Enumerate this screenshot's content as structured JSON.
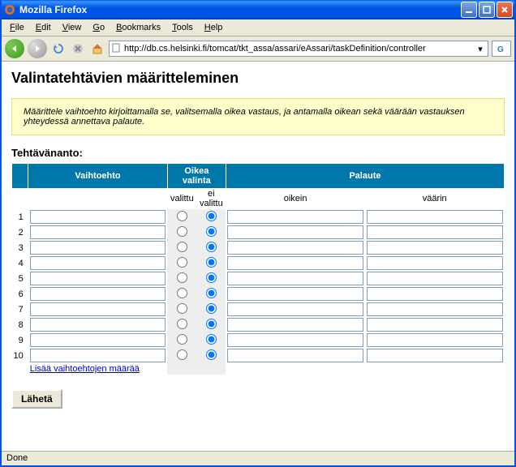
{
  "window": {
    "title": "Mozilla Firefox"
  },
  "menubar": {
    "file": "File",
    "edit": "Edit",
    "view": "View",
    "go": "Go",
    "bookmarks": "Bookmarks",
    "tools": "Tools",
    "help": "Help"
  },
  "toolbar": {
    "url": "http://db.cs.helsinki.fi/tomcat/tkt_assa/assari/eAssari/taskDefinition/controller"
  },
  "page": {
    "heading": "Valintatehtävien määritteleminen",
    "info": "Määrittele vaihtoehto kirjoittamalla se, valitsemalla oikea vastaus, ja antamalla oikean sekä väärään vastauksen yhteydessä annettava palaute.",
    "assignment_label": "Tehtävänanto:",
    "headers": {
      "option": "Vaihtoehto",
      "correct": "Oikea valinta",
      "feedback": "Palaute"
    },
    "subheaders": {
      "selected": "valittu",
      "not_selected": "ei valittu",
      "right": "oikein",
      "wrong": "väärin"
    },
    "rows": [
      {
        "n": "1",
        "opt": "",
        "sel": false,
        "fb_ok": "",
        "fb_bad": ""
      },
      {
        "n": "2",
        "opt": "",
        "sel": false,
        "fb_ok": "",
        "fb_bad": ""
      },
      {
        "n": "3",
        "opt": "",
        "sel": false,
        "fb_ok": "",
        "fb_bad": ""
      },
      {
        "n": "4",
        "opt": "",
        "sel": false,
        "fb_ok": "",
        "fb_bad": ""
      },
      {
        "n": "5",
        "opt": "",
        "sel": false,
        "fb_ok": "",
        "fb_bad": ""
      },
      {
        "n": "6",
        "opt": "",
        "sel": false,
        "fb_ok": "",
        "fb_bad": ""
      },
      {
        "n": "7",
        "opt": "",
        "sel": false,
        "fb_ok": "",
        "fb_bad": ""
      },
      {
        "n": "8",
        "opt": "",
        "sel": false,
        "fb_ok": "",
        "fb_bad": ""
      },
      {
        "n": "9",
        "opt": "",
        "sel": false,
        "fb_ok": "",
        "fb_bad": ""
      },
      {
        "n": "10",
        "opt": "",
        "sel": false,
        "fb_ok": "",
        "fb_bad": ""
      }
    ],
    "add_more": "Lisää vaihtoehtojen määrää",
    "submit": "Lähetä"
  },
  "status": "Done"
}
